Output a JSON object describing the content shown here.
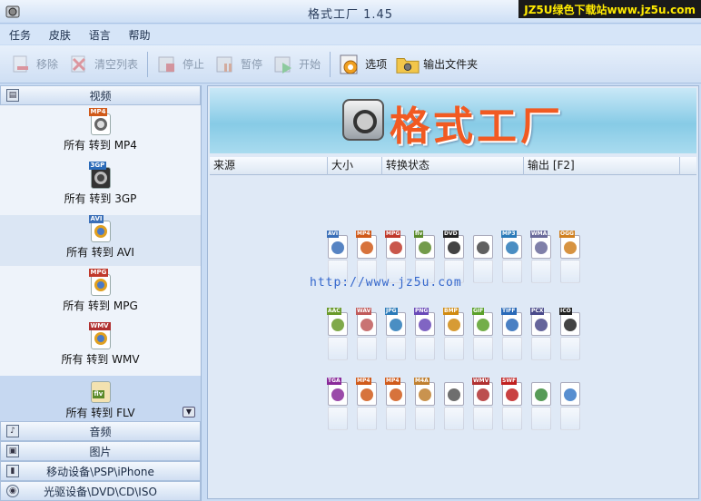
{
  "window": {
    "title": "格式工厂  1.45",
    "watermark": "JZ5U绿色下载站www.jz5u.com"
  },
  "menu": [
    "任务",
    "皮肤",
    "语言",
    "帮助"
  ],
  "toolbar": {
    "remove": "移除",
    "clear": "清空列表",
    "stop": "停止",
    "pause": "暂停",
    "start": "开始",
    "options": "选项",
    "output_folder": "输出文件夹"
  },
  "sidebar": {
    "video_header": "视频",
    "video_items": [
      {
        "label": "所有 转到 MP4",
        "tag": "MP4"
      },
      {
        "label": "所有 转到 3GP",
        "tag": "3GP"
      },
      {
        "label": "所有 转到 AVI",
        "tag": "AVI"
      },
      {
        "label": "所有 转到 MPG",
        "tag": "MPG"
      },
      {
        "label": "所有 转到 WMV",
        "tag": "WMV"
      },
      {
        "label": "所有 转到 FLV",
        "tag": "flv"
      }
    ],
    "audio": "音频",
    "image": "图片",
    "mobile": "移动设备\\PSP\\iPhone",
    "optical": "光驱设备\\DVD\\CD\\ISO"
  },
  "banner": {
    "title": "格式工厂"
  },
  "table": {
    "columns": [
      "来源",
      "大小",
      "转换状态",
      "输出 [F2]"
    ]
  },
  "overlay_url": "http://www.jz5u.com",
  "format_rows": [
    [
      {
        "tag": "AVI",
        "color": "#3a6fb8"
      },
      {
        "tag": "MP4",
        "color": "#d05a1a"
      },
      {
        "tag": "MPG",
        "color": "#c0392b"
      },
      {
        "tag": "flv",
        "color": "#5a8a2a"
      },
      {
        "tag": "DVD",
        "color": "#222222"
      },
      {
        "tag": "",
        "color": "#444444"
      },
      {
        "tag": "MP3",
        "color": "#2a7ab8"
      },
      {
        "tag": "WMA",
        "color": "#6a6a9a"
      },
      {
        "tag": "OGG",
        "color": "#d08020"
      }
    ],
    [
      {
        "tag": "AAC",
        "color": "#6a9a2a"
      },
      {
        "tag": "WAV",
        "color": "#c05a5a"
      },
      {
        "tag": "JPG",
        "color": "#2a7ab8"
      },
      {
        "tag": "PNG",
        "color": "#6a4ab8"
      },
      {
        "tag": "BMP",
        "color": "#d08a10"
      },
      {
        "tag": "GIF",
        "color": "#5aa02a"
      },
      {
        "tag": "TIFF",
        "color": "#2a6ab8"
      },
      {
        "tag": "PCX",
        "color": "#4a4a8a"
      },
      {
        "tag": "ICO",
        "color": "#222222"
      }
    ],
    [
      {
        "tag": "TGA",
        "color": "#8a2a9a"
      },
      {
        "tag": "MP4",
        "color": "#d05a1a"
      },
      {
        "tag": "MP4",
        "color": "#d05a1a"
      },
      {
        "tag": "M4A",
        "color": "#c08030"
      },
      {
        "tag": "",
        "color": "#555555"
      },
      {
        "tag": "WMV",
        "color": "#b03030"
      },
      {
        "tag": "SWF",
        "color": "#c02020"
      },
      {
        "tag": "",
        "color": "#3a8a3a"
      },
      {
        "tag": "",
        "color": "#3a7ac8"
      }
    ]
  ]
}
